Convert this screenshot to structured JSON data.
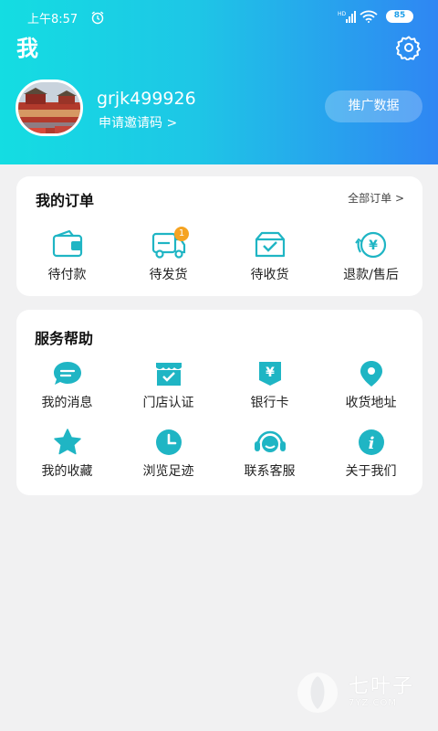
{
  "status_bar": {
    "time": "上午8:57",
    "battery": "85",
    "signal_tag": "HD"
  },
  "header": {
    "title": "我",
    "username": "grjk499926",
    "invite_label": "申请邀请码 >",
    "promo_button": "推广数据"
  },
  "orders": {
    "title": "我的订单",
    "all_label": "全部订单 >",
    "items": [
      {
        "label": "待付款",
        "icon": "wallet-icon"
      },
      {
        "label": "待发货",
        "icon": "delivery-truck-icon",
        "badge": "1"
      },
      {
        "label": "待收货",
        "icon": "inbox-icon"
      },
      {
        "label": "退款/售后",
        "icon": "refund-icon"
      }
    ]
  },
  "services": {
    "title": "服务帮助",
    "items": [
      {
        "label": "我的消息",
        "icon": "message-icon"
      },
      {
        "label": "门店认证",
        "icon": "store-icon"
      },
      {
        "label": "银行卡",
        "icon": "bank-card-icon"
      },
      {
        "label": "收货地址",
        "icon": "location-pin-icon"
      },
      {
        "label": "我的收藏",
        "icon": "star-icon"
      },
      {
        "label": "浏览足迹",
        "icon": "clock-icon"
      },
      {
        "label": "联系客服",
        "icon": "headset-icon"
      },
      {
        "label": "关于我们",
        "icon": "info-icon"
      }
    ]
  },
  "watermark": {
    "text": "七叶子",
    "sub": "7YZ.COM"
  },
  "colors": {
    "gradient_start": "#14dde2",
    "gradient_end": "#2f86f3",
    "icon_teal": "#1fbfd0",
    "badge": "#f5a321"
  }
}
